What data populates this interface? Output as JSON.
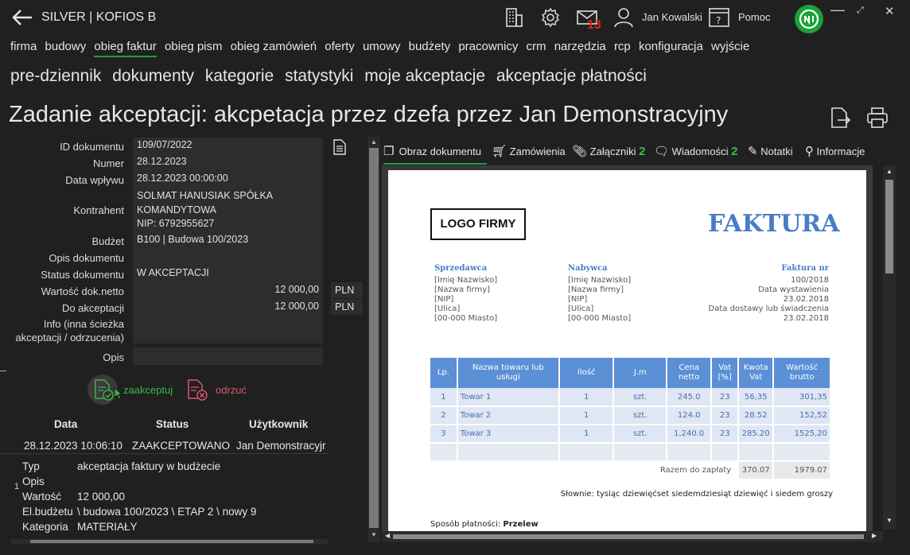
{
  "app": {
    "title": "SILVER | KOFIOS B",
    "user_name": "Jan Kowalski",
    "help_label": "Pomoc",
    "mail_count": "13"
  },
  "menu_main": [
    "firma",
    "budowy",
    "obieg faktur",
    "obieg pism",
    "obieg zamówień",
    "oferty",
    "umowy",
    "budżety",
    "pracownicy",
    "crm",
    "narzędzia",
    "rcp",
    "konfiguracja",
    "wyjście"
  ],
  "menu_sub": [
    "pre-dziennik",
    "dokumenty",
    "kategorie",
    "statystyki",
    "moje akceptacje",
    "akceptacje płatności"
  ],
  "page_title": "Zadanie akceptacji: akcpetacja przez dzefa przez Jan Demonstracyjny",
  "form": {
    "id_label": "ID dokumentu",
    "id_value": "109/07/2022",
    "numer_label": "Numer",
    "numer_value": "28.12.2023",
    "data_label": "Data wpływu",
    "data_value": "28.12.2023 00:00:00",
    "kontrahent_label": "Kontrahent",
    "kontrahent_l1": "SOLMAT HANUSIAK SPÓŁKA",
    "kontrahent_l2": "KOMANDYTOWA",
    "kontrahent_l3": "NIP: 6792955627",
    "budzet_label": "Budżet",
    "budzet_value": "B100 | Budowa 100/2023",
    "opis_dok_label": "Opis dokumentu",
    "opis_dok_value": "",
    "status_label": "Status dokumentu",
    "status_value": "W AKCEPTACJI",
    "netto_label": "Wartość dok.netto",
    "netto_value": "12 000,00",
    "netto_cur": "PLN",
    "doakc_label": "Do akceptacji",
    "doakc_value": "12 000,00",
    "doakc_cur": "PLN",
    "info_label_1": "Info (inna ścieżka",
    "info_label_2": "akceptacji / odrzucenia)",
    "opis_label": "Opis",
    "opis_value": ""
  },
  "actions": {
    "accept_label": "zaakceptuj",
    "reject_label": "odrzuć"
  },
  "history": {
    "headers": [
      "Data",
      "Status",
      "Użytkownik"
    ],
    "row": [
      "28.12.2023 10:06:10",
      "ZAAKCEPTOWANO",
      "Jan Demonstracyjr"
    ],
    "index": "1",
    "details": [
      {
        "k": "Typ",
        "v": "akceptacja faktury w budżecie"
      },
      {
        "k": "Opis",
        "v": ""
      },
      {
        "k": "Wartość",
        "v": "12 000,00"
      },
      {
        "k": "El.budżetu",
        "v": "\\ budowa 100/2023 \\ ETAP 2 \\ nowy 9"
      },
      {
        "k": "Kategoria",
        "v": "MATERIAŁY"
      }
    ]
  },
  "tabs": {
    "obraz": "Obraz dokumentu",
    "zamowienia": "Zamówienia",
    "zalaczniki": "Załączniki",
    "zalaczniki_count": "2",
    "wiadomosci": "Wiadomości",
    "wiadomosci_count": "2",
    "notatki": "Notatki",
    "informacje": "Informacje"
  },
  "invoice": {
    "logo": "LOGO FIRMY",
    "title": "FAKTURA",
    "seller_head": "Sprzedawca",
    "seller_lines": [
      "[Imię Nazwisko]",
      "[Nazwa firmy]",
      "[NIP]",
      "[Ulica]",
      "[00-000 Miasto]"
    ],
    "buyer_head": "Nabywca",
    "buyer_lines": [
      "[Imię Nazwisko]",
      "[Nazwa firmy]",
      "[NIP]",
      "[Ulica]",
      "[00-000 Miasto]"
    ],
    "nr_head": "Faktura nr",
    "nr_lines": [
      "100/2018",
      "Data wystawienia",
      "23.02.2018",
      "Data dostawy lub świadczenia",
      "23.02.2018"
    ],
    "columns": [
      "Lp.",
      "Nazwa towaru lub usługi",
      "Ilość",
      "J.m",
      "Cena netto",
      "Vat [%]",
      "Kwota Vat",
      "Wartość brutto"
    ],
    "rows": [
      [
        "1",
        "Towar 1",
        "1",
        "szt.",
        "245.0",
        "23",
        "56,35",
        "301,35"
      ],
      [
        "2",
        "Towar 2",
        "1",
        "szt.",
        "124.0",
        "23",
        "28.52",
        "152,52"
      ],
      [
        "3",
        "Towar 3",
        "1",
        "szt.",
        "1,240.0",
        "23",
        "285.20",
        "1525,20"
      ]
    ],
    "total_label": "Razem do zapłaty",
    "total_vat": "370.07",
    "total_gross": "1979.07",
    "words_label": "Słownie:",
    "words_value": "tysiąc dziewięćset siedemdziesiąt dziewięć i siedem groszy",
    "payment_label": "Sposób płatności:",
    "payment_value": "Przelew"
  },
  "colors": {
    "accent_green": "#1ba13a",
    "badge_red": "#e3231b",
    "reject_red": "#e0566b",
    "invoice_blue": "#5b8fd6"
  }
}
